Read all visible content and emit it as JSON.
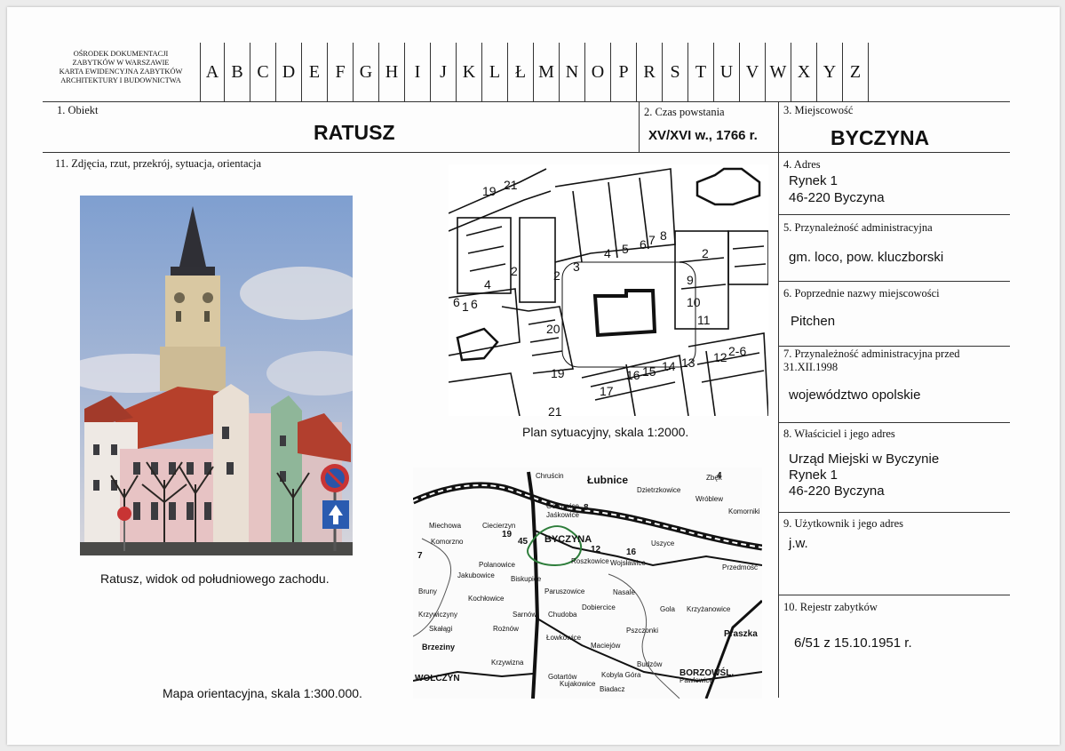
{
  "header": {
    "institution_lines": [
      "OŚRODEK DOKUMENTACJI",
      "ZABYTKÓW W WARSZAWIE",
      "KARTA EWIDENCYJNA ZABYTKÓW",
      "ARCHITEKTURY I BUDOWNICTWA"
    ],
    "letters": [
      "A",
      "B",
      "C",
      "D",
      "E",
      "F",
      "G",
      "H",
      "I",
      "J",
      "K",
      "L",
      "Ł",
      "M",
      "N",
      "O",
      "P",
      "R",
      "S",
      "T",
      "U",
      "V",
      "W",
      "X",
      "Y",
      "Z"
    ]
  },
  "field1": {
    "label": "1. Obiekt",
    "value": "RATUSZ"
  },
  "field2": {
    "label": "2. Czas powstania",
    "value": "XV/XVI w., 1766 r."
  },
  "field3": {
    "label": "3. Miejscowość",
    "value": "BYCZYNA"
  },
  "field11": {
    "label": "11. Zdjęcia, rzut, przekrój, sytuacja, orientacja"
  },
  "field4": {
    "label": "4. Adres",
    "value_lines": [
      "Rynek 1",
      "46-220 Byczyna"
    ]
  },
  "field5": {
    "label": "5. Przynależność administracyjna",
    "value": "gm. loco, pow. kluczborski"
  },
  "field6": {
    "label": "6. Poprzednie nazwy miejscowości",
    "value": "Pitchen"
  },
  "field7": {
    "label_lines": [
      "7. Przynależność administracyjna przed",
      "31.XII.1998"
    ],
    "value": "województwo opolskie"
  },
  "field8": {
    "label": "8. Właściciel i jego adres",
    "value_lines": [
      "Urząd Miejski w Byczynie",
      "Rynek 1",
      "46-220 Byczyna"
    ]
  },
  "field9": {
    "label": "9. Użytkownik i jego adres",
    "value": "j.w."
  },
  "field10": {
    "label": "10. Rejestr zabytków",
    "value": "6/51 z 15.10.1951 r."
  },
  "captions": {
    "photo": "Ratusz, widok od południowego zachodu.",
    "site_plan": "Plan sytuacyjny, skala 1:2000.",
    "orientation_map": "Mapa orientacyjna, skala 1:300.000."
  },
  "plan_numbers": [
    "19",
    "21",
    "2",
    "3",
    "4",
    "5",
    "6",
    "7",
    "8",
    "2",
    "9",
    "10",
    "11",
    "2",
    "4",
    "6",
    "1",
    "6",
    "17",
    "16",
    "15",
    "14",
    "13",
    "12",
    "2-6",
    "20",
    "19",
    "21"
  ],
  "map_places": [
    "Chruścin",
    "Łubnice",
    "Dzietrzkowice",
    "Zbęk",
    "Wróblew",
    "Komorniki",
    "Gołkowice",
    "Jaśkowice",
    "Miechowa",
    "Ciecierzyn",
    "Komorzno",
    "BYCZYNA",
    "Polanowice",
    "Roszkowice",
    "Wojsławice",
    "Uszyce",
    "Przedmość",
    "Jakubowice",
    "Biskupice",
    "Paruszowice",
    "Kochłowice",
    "Dobiercice",
    "Nasale",
    "Gola",
    "Krzyżanowice",
    "Bruny",
    "Krzywiczyny",
    "Sarnów",
    "Chudoba",
    "Skałągi",
    "Rożnów",
    "Łowkowice",
    "Maciejów",
    "Pszczonki",
    "Praszka",
    "Brzeziny",
    "Krzywizna",
    "Gotartów",
    "Kobyla Góra",
    "Budzów",
    "Pawłowice",
    "WOŁCZYN",
    "Kujakowice",
    "Biadacz",
    "BORZOWŚL."
  ],
  "map_numbers": [
    "45",
    "19",
    "16",
    "12",
    "7",
    "8",
    "4"
  ],
  "colors": {
    "sky": "#8ea9cf",
    "roof": "#b8412c",
    "tower": "#d8c9a6",
    "facade_pink": "#e6c2c3",
    "facade_green": "#8fb79a",
    "road": "#2d7d3a"
  }
}
